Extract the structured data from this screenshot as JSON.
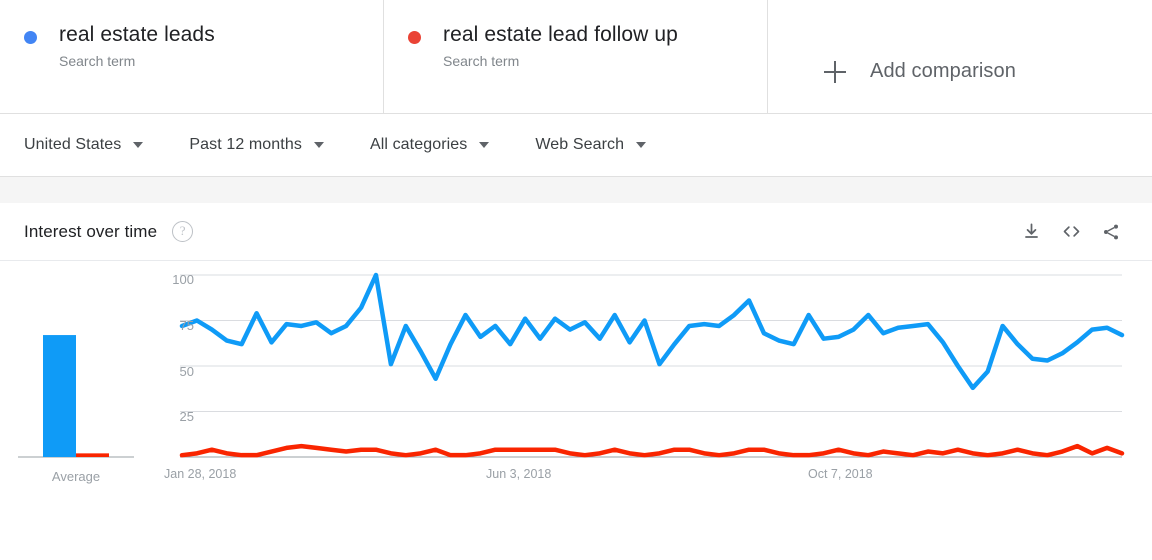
{
  "terms": [
    {
      "label": "real estate leads",
      "sublabel": "Search term",
      "color": "#4285f4"
    },
    {
      "label": "real estate lead follow up",
      "sublabel": "Search term",
      "color": "#ea4335"
    }
  ],
  "add_comparison": {
    "label": "Add comparison",
    "icon": "plus-icon"
  },
  "filters": [
    {
      "label": "United States"
    },
    {
      "label": "Past 12 months"
    },
    {
      "label": "All categories"
    },
    {
      "label": "Web Search"
    }
  ],
  "chart_header": {
    "title": "Interest over time",
    "help_glyph": "?",
    "actions": [
      {
        "name": "download-icon"
      },
      {
        "name": "embed-code-icon"
      },
      {
        "name": "share-icon"
      }
    ]
  },
  "average_panel": {
    "label": "Average",
    "values": [
      67,
      2
    ]
  },
  "chart_data": {
    "type": "line",
    "title": "Interest over time",
    "xlabel": "",
    "ylabel": "",
    "ylim": [
      0,
      100
    ],
    "yticks": [
      25,
      50,
      75,
      100
    ],
    "grid": true,
    "legend_position": "top",
    "x_tick_labels": [
      "Jan 28, 2018",
      "Jun 3, 2018",
      "Oct 7, 2018"
    ],
    "x_tick_indices": [
      0,
      18,
      36
    ],
    "series": [
      {
        "name": "real estate leads",
        "color": "#0f9bf7",
        "values": [
          72,
          75,
          70,
          64,
          62,
          79,
          63,
          73,
          72,
          74,
          68,
          72,
          82,
          100,
          51,
          72,
          58,
          43,
          62,
          78,
          66,
          72,
          62,
          76,
          65,
          76,
          70,
          74,
          65,
          78,
          63,
          75,
          51,
          62,
          72,
          73,
          72,
          78,
          86,
          68,
          64,
          62,
          78,
          65,
          66,
          70,
          78,
          68,
          71,
          72,
          73,
          63,
          50,
          38,
          47,
          72,
          62,
          54,
          53,
          57,
          63,
          70,
          71,
          67
        ]
      },
      {
        "name": "real estate lead follow up",
        "color": "#f92500",
        "values": [
          1,
          2,
          4,
          2,
          1,
          1,
          3,
          5,
          6,
          5,
          4,
          3,
          4,
          4,
          2,
          1,
          2,
          4,
          1,
          1,
          2,
          4,
          4,
          4,
          4,
          4,
          2,
          1,
          2,
          4,
          2,
          1,
          2,
          4,
          4,
          2,
          1,
          2,
          4,
          4,
          2,
          1,
          1,
          2,
          4,
          2,
          1,
          3,
          2,
          1,
          3,
          2,
          4,
          2,
          1,
          2,
          4,
          2,
          1,
          3,
          6,
          2,
          5,
          2
        ]
      }
    ]
  }
}
